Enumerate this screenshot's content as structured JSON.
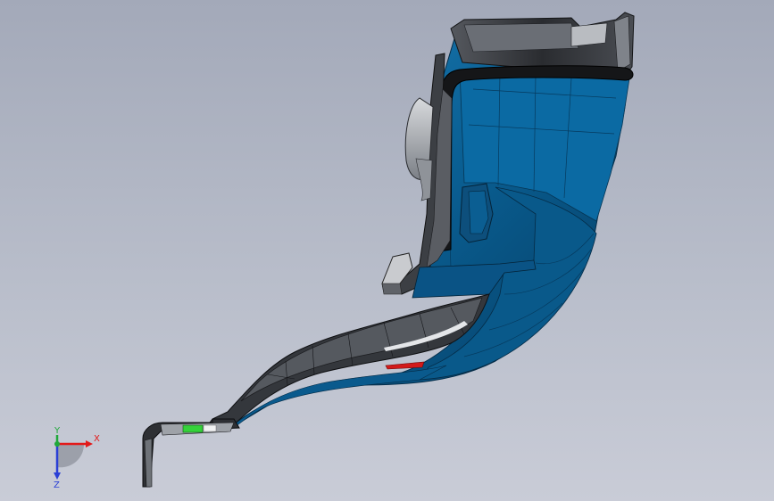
{
  "triad": {
    "x_label": "X",
    "y_label": "Y",
    "z_label": "Z"
  },
  "colors": {
    "background_top": "#a3a9b9",
    "background_bottom": "#c9ccd7",
    "part_blue": "#0a5f93",
    "part_dark": "#2f3135",
    "x_axis": "#e21a1a",
    "y_axis": "#1fa83a",
    "z_axis": "#2a3fd6"
  }
}
